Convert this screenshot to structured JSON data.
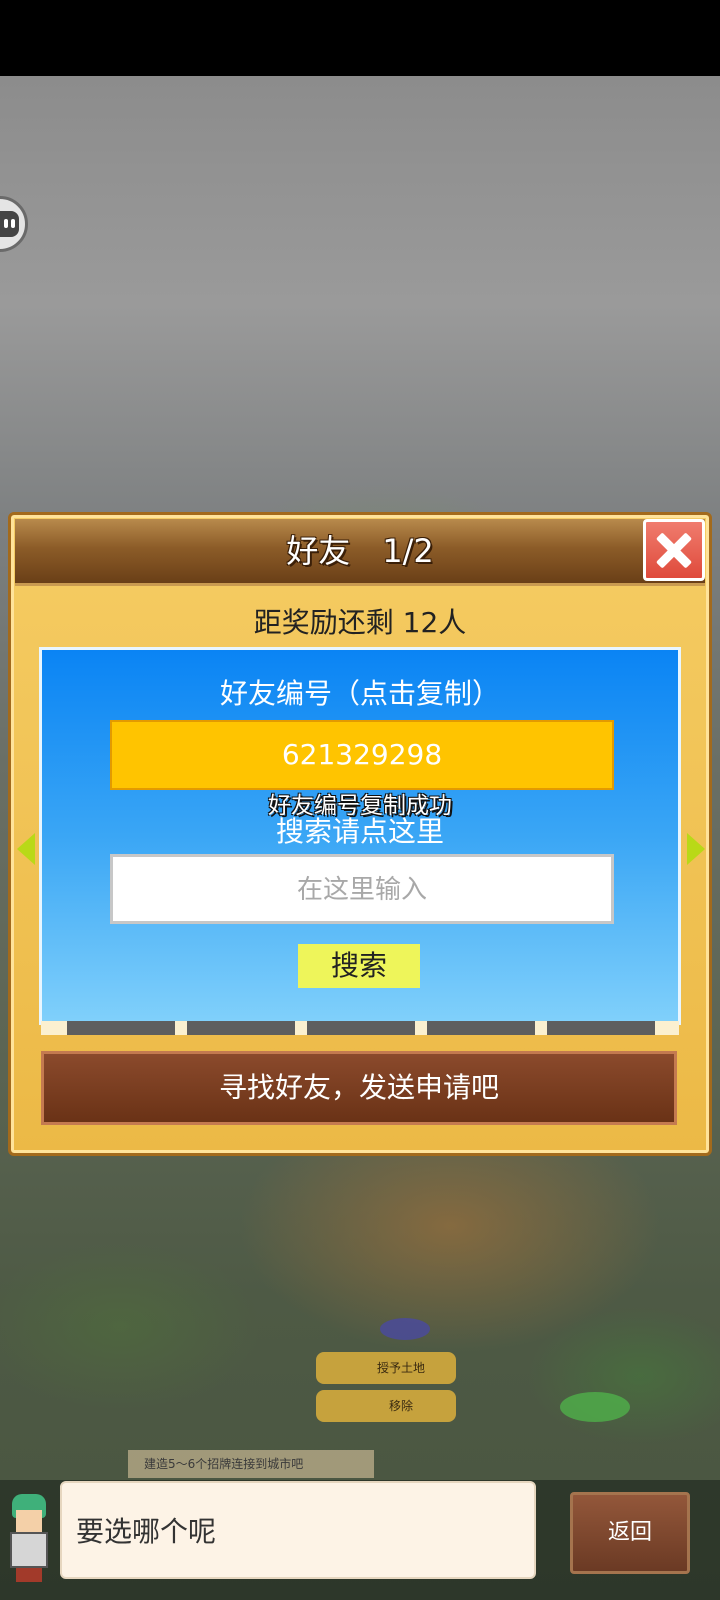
{
  "dialog": {
    "title": "好友",
    "page": "1/2",
    "reward_remaining": "距奖励还剩 12人",
    "friend_id_label": "好友编号（点击复制）",
    "friend_id": "621329298",
    "copy_success": "好友编号复制成功",
    "search_hint": "搜索请点这里",
    "search_placeholder": "在这里输入",
    "search_button": "搜索",
    "find_friends_button": "寻找好友，发送申请吧"
  },
  "map": {
    "grant_land_button": "授予土地",
    "remove_button": "移除",
    "hint": "建造5～6个招牌连接到城市吧"
  },
  "bottom": {
    "speech": "要选哪个呢",
    "back_button": "返回"
  },
  "colors": {
    "panel_blue": "#0a84f4",
    "id_box": "#ffc400",
    "search_button": "#eef55a",
    "close_red": "#df4a3b"
  }
}
